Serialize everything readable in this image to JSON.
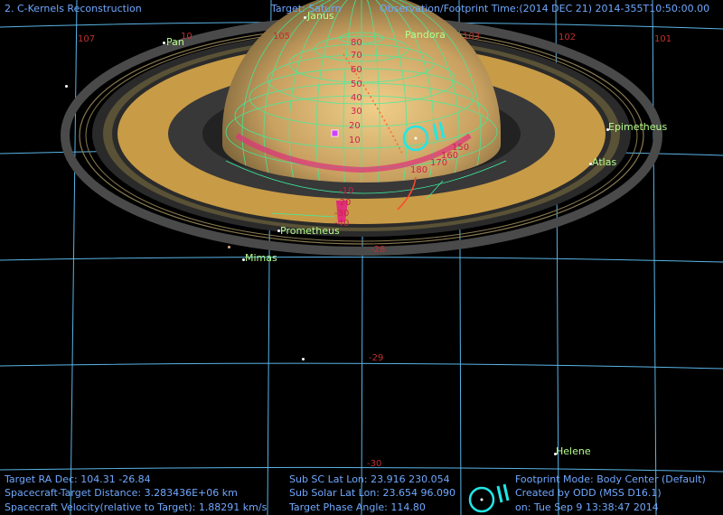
{
  "header": {
    "window_title": "2. C-Kernels Reconstruction",
    "target": "Target: Saturn",
    "observation_time": "Observation/Footprint Time:(2014 DEC 21) 2014-355T10:50:00.00"
  },
  "moons": {
    "janus": "Janus",
    "pan": "Pan",
    "pandora": "Pandora",
    "epimetheus": "Epimetheus",
    "atlas": "Atlas",
    "prometheus": "Prometheus",
    "mimas": "Mimas",
    "helene": "Helene"
  },
  "ra_labels": {
    "l107": "107",
    "l103": "103",
    "l102": "102",
    "l101": "101",
    "l10a": "10",
    "l105": "105"
  },
  "dec_labels": {
    "d28": "-28",
    "d29": "-29",
    "d30": "-30"
  },
  "latitude_labels": {
    "p80": "80",
    "p70": "70",
    "p60": "60",
    "p50": "50",
    "p40": "40",
    "p30": "30",
    "p20": "20",
    "p10": "10",
    "n10": "-10",
    "n20": "-20",
    "n30": "-30",
    "n40": "-40",
    "e150": "150",
    "e160": "160",
    "e170": "170",
    "e180": "180"
  },
  "footer": {
    "ra_dec": "Target RA Dec: 104.31   -26.84",
    "distance": "Spacecraft-Target Distance: 3.283436E+06 km",
    "velocity": "Spacecraft Velocity(relative to Target): 1.88291 km/s",
    "sub_sc": "Sub SC Lat Lon: 23.916  230.054",
    "sub_solar": "Sub Solar Lat Lon: 23.654   96.090",
    "phase": "Target Phase Angle: 114.80",
    "footprint_mode": "Footprint Mode: Body Center (Default)",
    "created_by": "Created by ODD (MSS D16.1)",
    "created_on": "on: Tue Sep  9 13:38:47 2014"
  },
  "colors": {
    "background": "#000000",
    "grid_lines": "#5ab4e6",
    "planet_grid": "#3cf0a0",
    "ring_gold": "#c89b46",
    "ring_dark": "#2a2a2a",
    "marker_cyan": "#22e6e6",
    "accent_magenta": "#e0307a"
  },
  "icons": {
    "footprint_marker": "target-circle-icon",
    "spacecraft": "spacecraft-icon"
  }
}
